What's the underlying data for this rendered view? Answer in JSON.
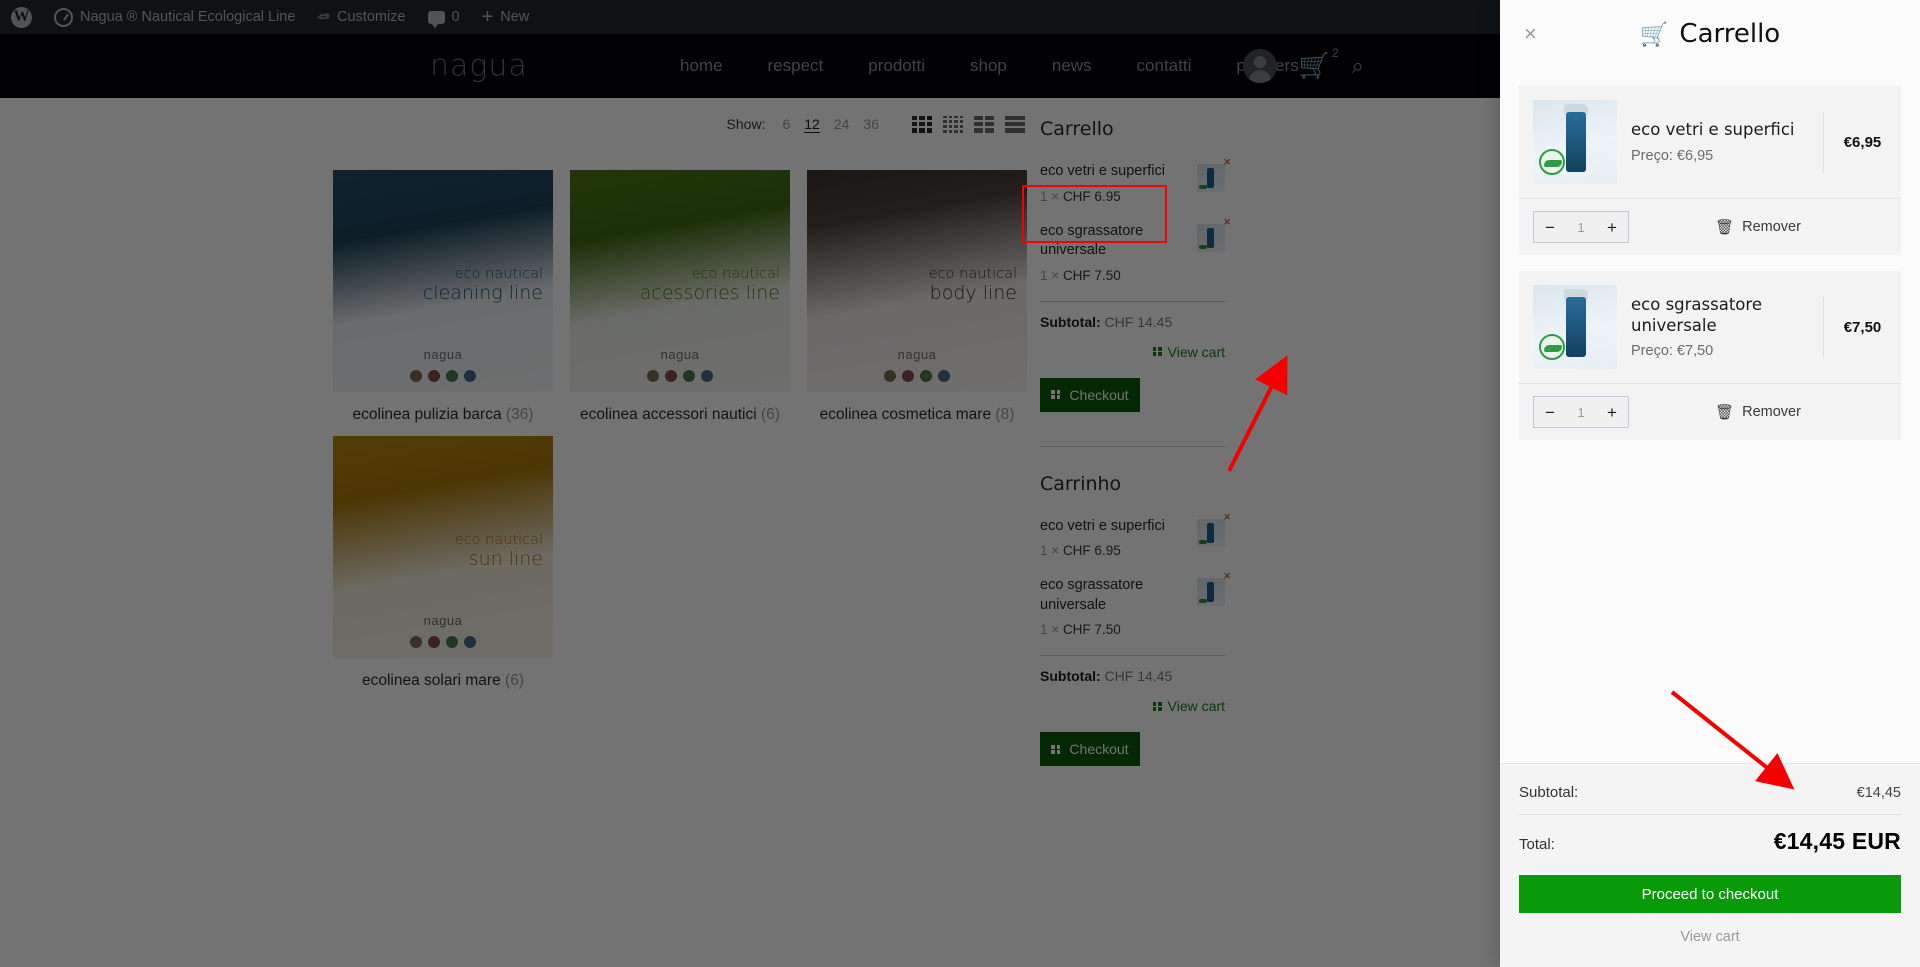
{
  "admin_bar": {
    "items": [
      {
        "icon": "wordpress-logo-icon",
        "label": ""
      },
      {
        "icon": "dashboard-icon",
        "label": "Nagua ® Nautical Ecological Line"
      },
      {
        "icon": "pencil-icon",
        "label": "Customize"
      },
      {
        "icon": "comment-icon",
        "label": "0"
      },
      {
        "icon": "plus-icon",
        "label": "New"
      }
    ]
  },
  "site_header": {
    "logo": "nagua",
    "nav": [
      "home",
      "respect",
      "prodotti",
      "shop",
      "news",
      "contatti",
      "partners"
    ],
    "cart_badge": "2",
    "icons": [
      "account-avatar-icon",
      "cart-icon",
      "search-icon"
    ]
  },
  "shop_toolbar": {
    "show_label": "Show:",
    "options": [
      "6",
      "12",
      "24",
      "36"
    ],
    "active_option": "12",
    "view_icons": [
      "grid-3-icon",
      "grid-4-icon",
      "grid-2-icon",
      "list-icon"
    ]
  },
  "products": [
    {
      "line_top": "eco nautical",
      "line_bottom": "cleaning line",
      "logo": "nagua",
      "text_color": "#1d5570",
      "caption": "ecolinea pulizia barca",
      "count": "(36)",
      "wash": "wash-blue"
    },
    {
      "line_top": "eco nautical",
      "line_bottom": "acessories line",
      "logo": "nagua",
      "text_color": "#4e7a16",
      "caption": "ecolinea accessori nautici",
      "count": "(6)",
      "wash": "wash-green"
    },
    {
      "line_top": "eco nautical",
      "line_bottom": "body line",
      "logo": "nagua",
      "text_color": "#3a3430",
      "caption": "ecolinea cosmetica mare",
      "count": "(8)",
      "wash": "wash-body"
    },
    {
      "line_top": "eco nautical",
      "line_bottom": "sun line",
      "logo": "nagua",
      "text_color": "#a8780c",
      "caption": "ecolinea solari mare",
      "count": "(6)",
      "wash": "wash-sun"
    }
  ],
  "sidebar": {
    "widgets": [
      {
        "title": "Carrello",
        "items": [
          {
            "name": "eco vetri e superfici",
            "qty": "1",
            "times": "×",
            "price": "CHF 6.95",
            "remove": "×"
          },
          {
            "name": "eco sgrassatore universale",
            "qty": "1",
            "times": "×",
            "price": "CHF 7.50",
            "remove": "×"
          }
        ],
        "subtotal_label": "Subtotal:",
        "subtotal_value": "CHF 14.45",
        "view_cart": "View cart",
        "checkout": "Checkout"
      },
      {
        "title": "Carrinho",
        "items": [
          {
            "name": "eco vetri e superfici",
            "qty": "1",
            "times": "×",
            "price": "CHF 6.95",
            "remove": "×"
          },
          {
            "name": "eco sgrassatore universale",
            "qty": "1",
            "times": "×",
            "price": "CHF 7.50",
            "remove": "×"
          }
        ],
        "subtotal_label": "Subtotal:",
        "subtotal_value": "CHF 14.45",
        "view_cart": "View cart",
        "checkout": "Checkout"
      }
    ]
  },
  "cart_panel": {
    "title": "Carrello",
    "close_label": "×",
    "items": [
      {
        "name": "eco vetri e superfici",
        "price_label": "Preço: €6,95",
        "line_total": "€6,95",
        "qty": "1",
        "minus": "−",
        "plus": "+",
        "remove_label": "Remover"
      },
      {
        "name": "eco sgrassatore universale",
        "price_label": "Preço: €7,50",
        "line_total": "€7,50",
        "qty": "1",
        "minus": "−",
        "plus": "+",
        "remove_label": "Remover"
      }
    ],
    "subtotal_label": "Subtotal:",
    "subtotal_value": "€14,45",
    "total_label": "Total:",
    "total_value": "€14,45 EUR",
    "checkout_label": "Proceed to checkout",
    "view_cart_label": "View cart",
    "checkout_color": "#089a09"
  },
  "annotations": {
    "highlight_color": "#f50000",
    "arrow_color": "#f50000",
    "arrow_count": "2"
  }
}
